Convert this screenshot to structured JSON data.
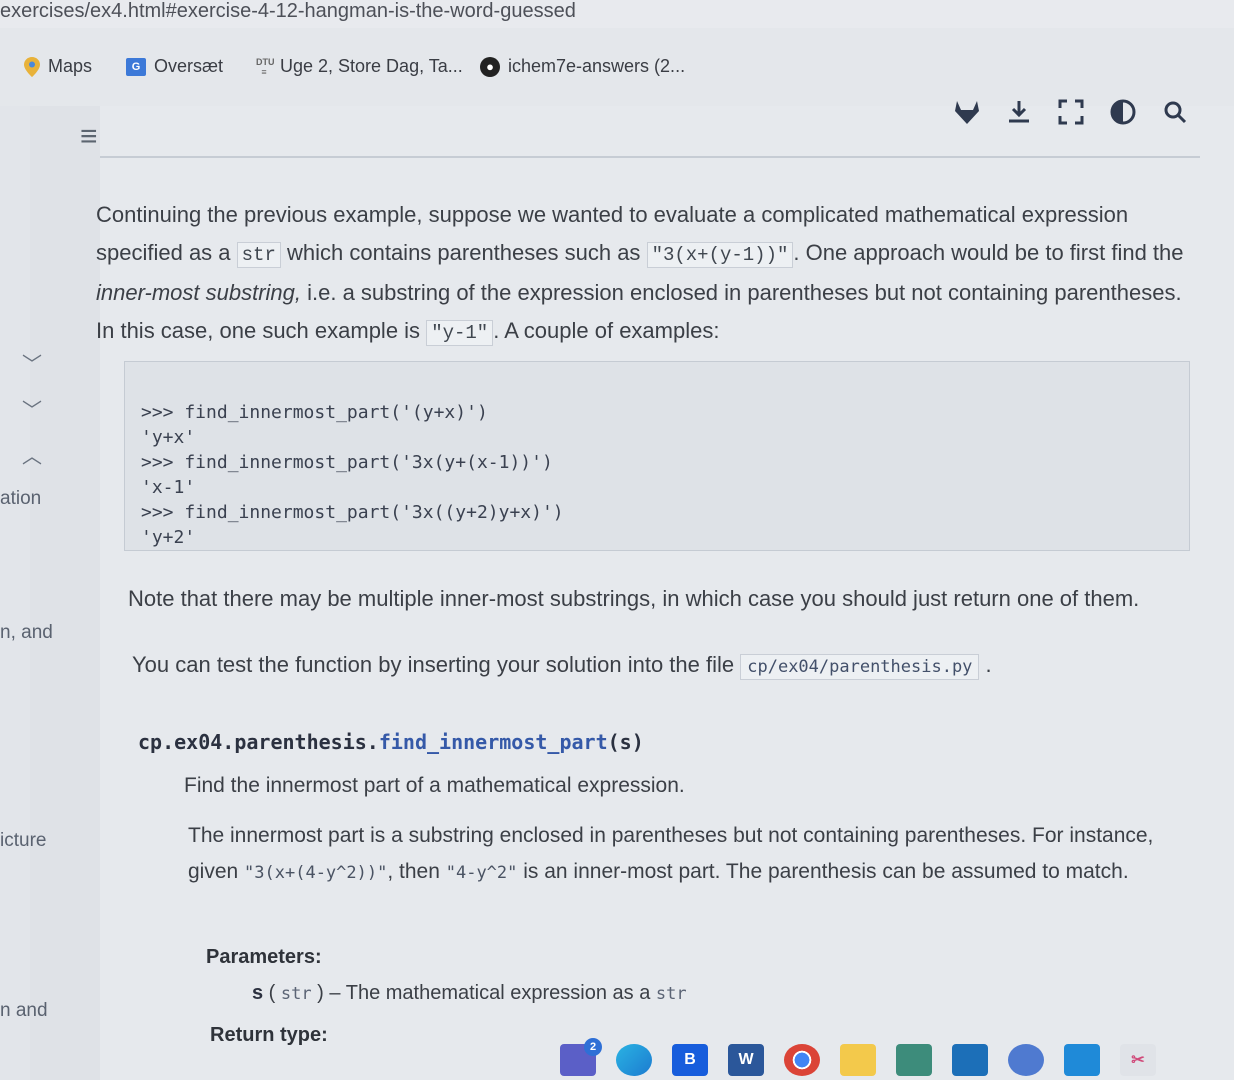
{
  "browser": {
    "url": "exercises/ex4.html#exercise-4-12-hangman-is-the-word-guessed"
  },
  "bookmarks": [
    {
      "label": "Maps",
      "icon": "map-pin-icon"
    },
    {
      "label": "Oversæt",
      "icon": "translate-icon"
    },
    {
      "label": "Uge 2, Store Dag, Ta...",
      "icon": "calendar-icon"
    },
    {
      "label": "ichem7e-answers (2...",
      "icon": "github-icon"
    }
  ],
  "toolbar": {
    "icons": [
      "gitlab-icon",
      "download-icon",
      "fullscreen-icon",
      "contrast-icon",
      "search-icon"
    ]
  },
  "sidebar_fragments": [
    "ation",
    "n, and",
    "icture",
    "n and"
  ],
  "content": {
    "intro_1": "Continuing the previous example, suppose we wanted to evaluate a complicated mathematical expression",
    "intro_2a": "specified as a",
    "intro_str": "str",
    "intro_2b": "which contains parentheses such as",
    "intro_expr": "\"3(x+(y-1))\"",
    "intro_2c": ". One approach would be to first find the",
    "intro_3_italic": "inner-most substring,",
    "intro_3": " i.e. a substring of the expression enclosed in parentheses but not containing parentheses.",
    "intro_4a": "In this case, one such example is",
    "intro_4_code": "\"y-1\"",
    "intro_4b": ". A couple of examples:",
    "code_block": ">>> find_innermost_part('(y+x)')\n'y+x'\n>>> find_innermost_part('3x(y+(x-1))')\n'x-1'\n>>> find_innermost_part('3x((y+2)y+x)')\n'y+2'",
    "note": "Note that there may be multiple inner-most substrings, in which case you should just return one of them.",
    "test_a": "You can test the function by inserting your solution into the file",
    "test_file": "cp/ex04/parenthesis.py",
    "test_b": ".",
    "signature_module": "cp.ex04.parenthesis.",
    "signature_fn": "find_innermost_part",
    "signature_args": "(s)",
    "doc_summary": "Find the innermost part of a mathematical expression.",
    "doc_body_1": "The innermost part is a substring enclosed in parentheses but not containing parentheses. For instance,",
    "doc_body_2a": "given",
    "doc_body_expr": "\"3(x+(4-y^2))\"",
    "doc_body_2b": ", then",
    "doc_body_inner": "\"4-y^2\"",
    "doc_body_2c": "is an inner-most part. The parenthesis can be assumed to match.",
    "params_heading": "Parameters:",
    "param_name": "s",
    "param_type": "str",
    "param_desc": "– The mathematical expression as a",
    "param_desc_type": "str",
    "return_heading": "Return type:"
  },
  "taskbar": {
    "badge_count": "2",
    "apps": [
      "chat-icon",
      "edge-icon",
      "bitwarden-icon",
      "word-icon",
      "chrome-icon",
      "file-explorer-icon",
      "settings-icon",
      "store-icon",
      "messenger-icon",
      "vscode-icon",
      "snipping-tool-icon"
    ],
    "labels": {
      "bitwarden": "B",
      "word": "W"
    }
  }
}
